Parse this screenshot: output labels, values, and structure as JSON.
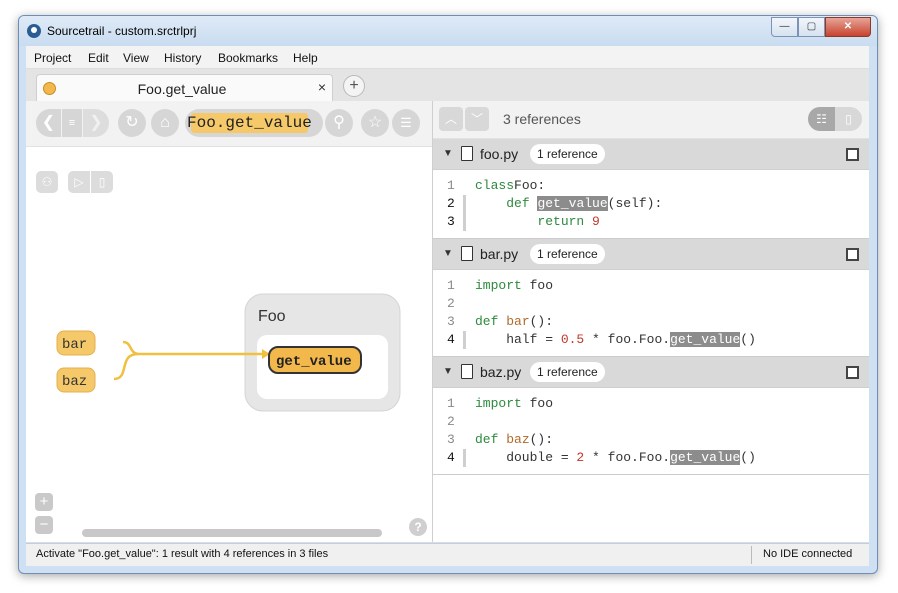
{
  "window": {
    "title": "Sourcetrail - custom.srctrlprj"
  },
  "titlebar_buttons": {
    "minimize": "—",
    "maximize": "▢",
    "close": "✕"
  },
  "menu": [
    "Project",
    "Edit",
    "View",
    "History",
    "Bookmarks",
    "Help"
  ],
  "tab": {
    "label": "Foo.get_value",
    "close": "×",
    "add": "+"
  },
  "search": {
    "text": "Foo.get_value"
  },
  "graph": {
    "class_node": "Foo",
    "member_node": "get_value",
    "callers": [
      "bar",
      "baz"
    ],
    "colors": {
      "accent": "#f5c96a",
      "accent_border": "#e3b04e",
      "active": "#f2b84b",
      "edge": "#f0c040",
      "class_bg": "#e6e6e6"
    }
  },
  "zoom": {
    "in": "+",
    "out": "−",
    "help": "?"
  },
  "references": {
    "count_label": "3 references",
    "files": [
      {
        "name": "foo.py",
        "badge": "1 reference",
        "lines": [
          {
            "n": "1",
            "active": false,
            "parts": [
              [
                "kw",
                "class"
              ],
              [
                "",
                "Foo:"
              ]
            ]
          },
          {
            "n": "2",
            "active": true,
            "parts": [
              [
                "",
                "    "
              ],
              [
                "kw",
                "def "
              ],
              [
                "hl",
                "get_value"
              ],
              [
                "",
                "(self):"
              ]
            ]
          },
          {
            "n": "3",
            "active": true,
            "parts": [
              [
                "",
                "        "
              ],
              [
                "kw",
                "return "
              ],
              [
                "num",
                "9"
              ]
            ]
          }
        ]
      },
      {
        "name": "bar.py",
        "badge": "1 reference",
        "lines": [
          {
            "n": "1",
            "active": false,
            "parts": [
              [
                "kw",
                "import "
              ],
              [
                "",
                "foo"
              ]
            ]
          },
          {
            "n": "2",
            "active": false,
            "parts": []
          },
          {
            "n": "3",
            "active": false,
            "parts": [
              [
                "kw",
                "def "
              ],
              [
                "fn",
                "bar"
              ],
              [
                "",
                "():"
              ]
            ]
          },
          {
            "n": "4",
            "active": true,
            "parts": [
              [
                "",
                "    half = "
              ],
              [
                "num",
                "0.5"
              ],
              [
                "",
                " * foo.Foo."
              ],
              [
                "hl",
                "get_value"
              ],
              [
                "",
                "()"
              ]
            ]
          }
        ]
      },
      {
        "name": "baz.py",
        "badge": "1 reference",
        "lines": [
          {
            "n": "1",
            "active": false,
            "parts": [
              [
                "kw",
                "import "
              ],
              [
                "",
                "foo"
              ]
            ]
          },
          {
            "n": "2",
            "active": false,
            "parts": []
          },
          {
            "n": "3",
            "active": false,
            "parts": [
              [
                "kw",
                "def "
              ],
              [
                "fn",
                "baz"
              ],
              [
                "",
                "():"
              ]
            ]
          },
          {
            "n": "4",
            "active": true,
            "parts": [
              [
                "",
                "    double = "
              ],
              [
                "num",
                "2"
              ],
              [
                "",
                " * foo.Foo."
              ],
              [
                "hl",
                "get_value"
              ],
              [
                "",
                "()"
              ]
            ]
          }
        ]
      }
    ]
  },
  "status": {
    "message": "Activate \"Foo.get_value\": 1 result with 4 references in 3 files",
    "ide": "No IDE connected"
  }
}
